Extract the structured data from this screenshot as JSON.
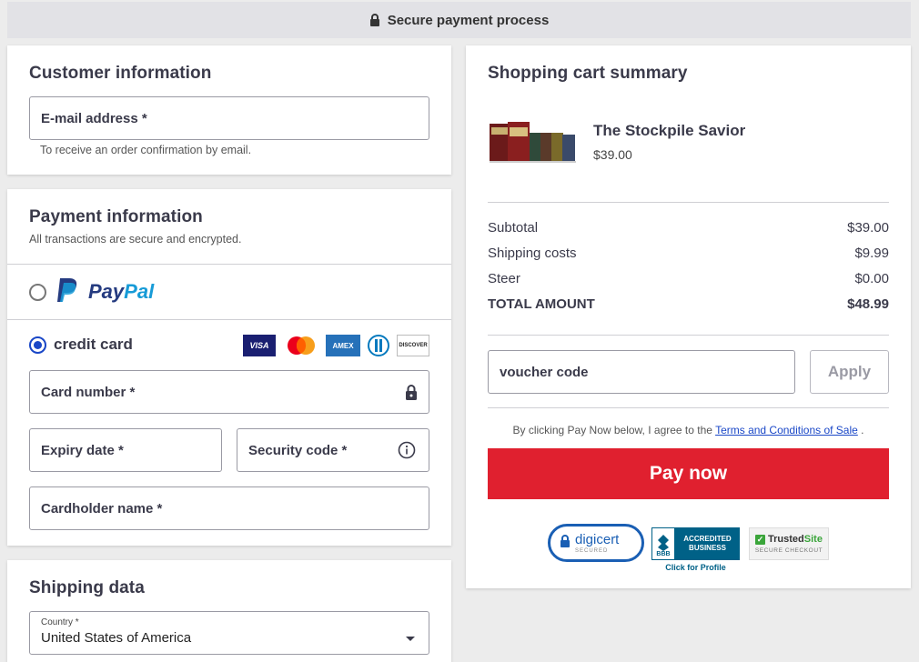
{
  "header": {
    "title": "Secure payment process",
    "icon": "lock-icon"
  },
  "customer": {
    "title": "Customer information",
    "email_label": "E-mail address *",
    "email_hint": "To receive an order confirmation by email."
  },
  "payment": {
    "title": "Payment information",
    "subtitle": "All transactions are secure and encrypted.",
    "paypal_label_1": "Pay",
    "paypal_label_2": "Pal",
    "credit_label": "credit card",
    "card_logos": [
      "VISA",
      "Mastercard",
      "AMEX",
      "Diners",
      "DISCOVER"
    ],
    "card_number": "Card number *",
    "expiry": "Expiry date *",
    "security": "Security code *",
    "cardholder": "Cardholder name *",
    "selected_method": "credit card"
  },
  "shipping": {
    "title": "Shipping data",
    "country_label": "Country *",
    "country_value": "United States of America"
  },
  "cart": {
    "title": "Shopping cart summary",
    "product_name": "The Stockpile Savior",
    "product_price": "$39.00",
    "rows": [
      {
        "label": "Subtotal",
        "value": "$39.00"
      },
      {
        "label": "Shipping costs",
        "value": "$9.99"
      },
      {
        "label": "Steer",
        "value": "$0.00"
      }
    ],
    "total_label": "TOTAL AMOUNT",
    "total_value": "$48.99",
    "voucher_placeholder": "voucher code",
    "apply_label": "Apply",
    "terms_prefix": "By clicking Pay Now below, I agree to the ",
    "terms_link": "Terms and Conditions of Sale",
    "terms_suffix": " .",
    "pay_label": "Pay now"
  },
  "badges": {
    "digicert": "digicert",
    "digicert_sub": "SECURED",
    "bbb_1": "ACCREDITED",
    "bbb_2": "BUSINESS",
    "bbb_logo": "BBB",
    "bbb_click": "Click for Profile",
    "trusted_1": "Trusted",
    "trusted_2": "Site",
    "trusted_sub": "SECURE CHECKOUT"
  },
  "colors": {
    "accent_blue": "#1a47c7",
    "pay_red": "#e0202f",
    "paypal_dark": "#253b80",
    "paypal_light": "#179bd7"
  }
}
